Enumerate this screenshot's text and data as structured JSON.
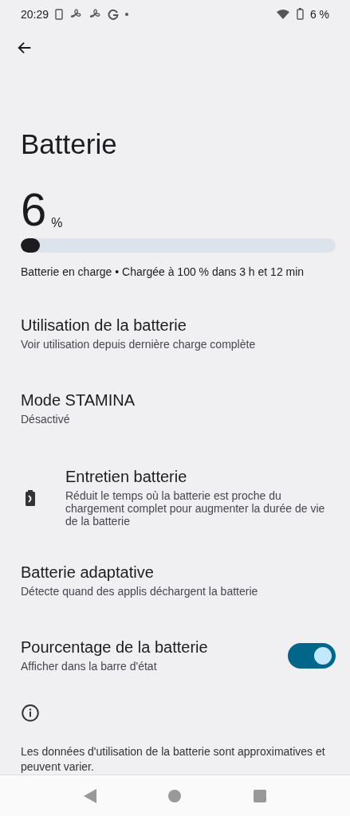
{
  "status_bar": {
    "time": "20:29",
    "battery_text": "6 %"
  },
  "title": "Batterie",
  "battery": {
    "percent": "6",
    "unit": "%",
    "level": 0.06,
    "charging_text": "Batterie en charge • Chargée à 100 % dans 3 h et 12 min"
  },
  "items": [
    {
      "kind": "plain",
      "title": "Utilisation de la batterie",
      "summary": "Voir utilisation depuis dernière charge complète"
    },
    {
      "kind": "plain",
      "title": "Mode STAMINA",
      "summary": "Désactivé"
    },
    {
      "kind": "icon",
      "title": "Entretien batterie",
      "summary": "Réduit le temps où la batterie est proche du chargement complet pour augmenter la durée de vie de la batterie"
    },
    {
      "kind": "plain",
      "title": "Batterie adaptative",
      "summary": "Détecte quand des applis déchargent la batterie"
    },
    {
      "kind": "toggle",
      "title": "Pourcentage de la batterie",
      "summary": "Afficher dans la barre d'état",
      "on": true
    }
  ],
  "footer": "Les données d'utilisation de la batterie sont approximatives et peuvent varier."
}
